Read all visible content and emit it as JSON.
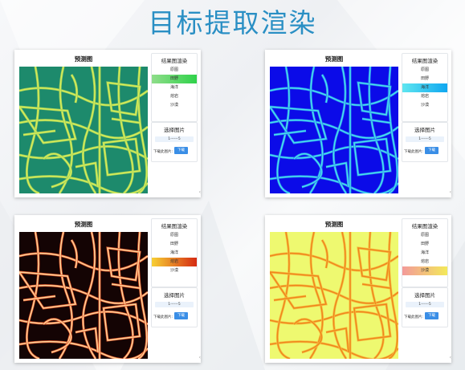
{
  "slide_title": "目标提取渲染",
  "panels": [
    {
      "prediction_title": "预测图",
      "render_title": "结果图渲染",
      "render_options": [
        "原图",
        "田野",
        "海洋",
        "熔岩",
        "沙漠"
      ],
      "active_option": "田野",
      "select_title": "选择图片",
      "image_range": "1------5",
      "download_label": "下载此图片:",
      "download_button": "下载",
      "map_colors": {
        "background": "#1d8a6c",
        "road": "#d7ec57",
        "edge": "#9ccf5d"
      }
    },
    {
      "prediction_title": "预测图",
      "render_title": "结果图渲染",
      "render_options": [
        "原图",
        "田野",
        "海洋",
        "熔岩",
        "沙漠"
      ],
      "active_option": "海洋",
      "select_title": "选择图片",
      "image_range": "1------5",
      "download_label": "下载此图片:",
      "download_button": "下载",
      "map_colors": {
        "background": "#0b0be8",
        "road": "#46e4ec",
        "edge": "#2a7cf0"
      }
    },
    {
      "prediction_title": "预测图",
      "render_title": "结果图渲染",
      "render_options": [
        "原图",
        "田野",
        "海洋",
        "熔岩",
        "沙漠"
      ],
      "active_option": "熔岩",
      "select_title": "选择图片",
      "image_range": "1------5",
      "download_label": "下载此图片:",
      "download_button": "下载",
      "map_colors": {
        "background": "#140404",
        "road": "#ffd49a",
        "edge": "#e0552a"
      }
    },
    {
      "prediction_title": "预测图",
      "render_title": "结果图渲染",
      "render_options": [
        "原图",
        "田野",
        "海洋",
        "熔岩",
        "沙漠"
      ],
      "active_option": "沙漠",
      "select_title": "选择图片",
      "image_range": "1------5",
      "download_label": "下载此图片:",
      "download_button": "下载",
      "map_colors": {
        "background": "#eef970",
        "road": "#f0861c",
        "edge": "#f5c040"
      }
    }
  ],
  "option_highlights": {
    "田野": [
      "#8fdd8a",
      "#2fd24a"
    ],
    "海洋": [
      "#5fe6f0",
      "#0fa7f0"
    ],
    "熔岩": [
      "#f7d034",
      "#d52a12"
    ],
    "沙漠": [
      "#f39a9a",
      "#f3e95a"
    ]
  }
}
